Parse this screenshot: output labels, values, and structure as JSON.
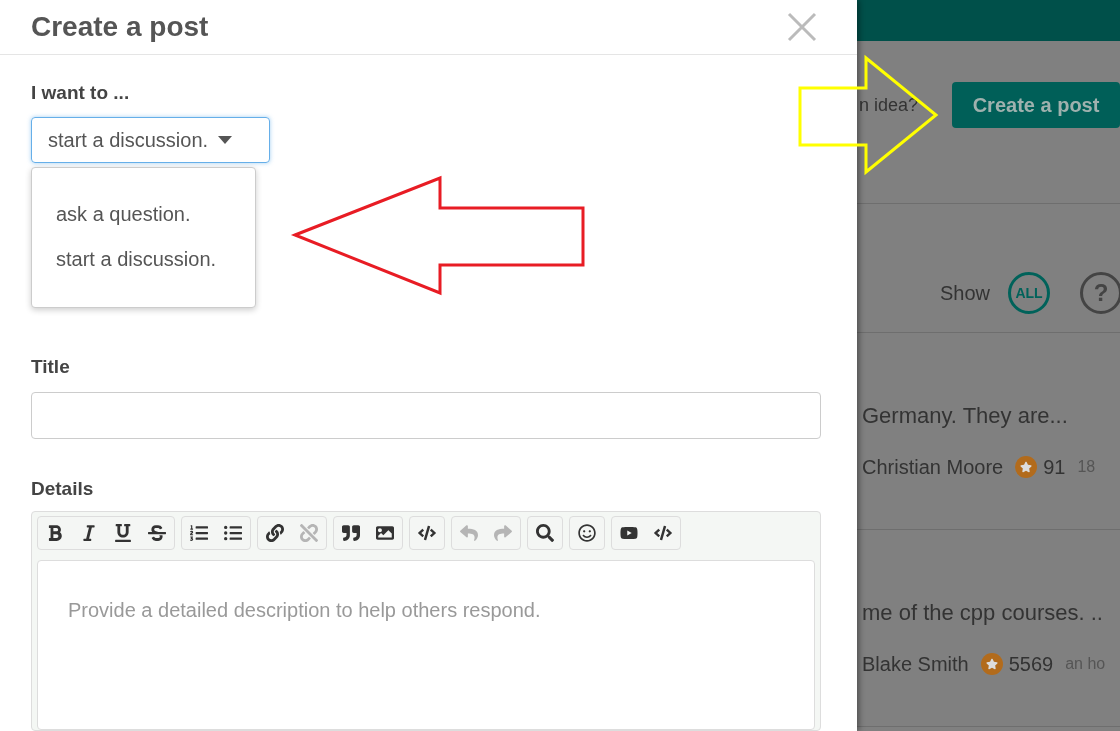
{
  "modal": {
    "title": "Create a post",
    "intent": {
      "label": "I want to ...",
      "value": "start a discussion.",
      "expanded": true,
      "options": [
        {
          "label": "ask a question."
        },
        {
          "label": "start a discussion."
        }
      ]
    },
    "title_field": {
      "label": "Title"
    },
    "details": {
      "label": "Details",
      "placeholder": "Provide a detailed description to help others respond.",
      "toolbar": [
        [
          {
            "kind": "bold",
            "disabled": false
          },
          {
            "kind": "italic",
            "disabled": false
          },
          {
            "kind": "underline",
            "disabled": false
          },
          {
            "kind": "strike",
            "disabled": false
          }
        ],
        [
          {
            "kind": "ordered-list",
            "disabled": false
          },
          {
            "kind": "bullet-list",
            "disabled": false
          }
        ],
        [
          {
            "kind": "link",
            "disabled": false
          },
          {
            "kind": "unlink",
            "disabled": true
          }
        ],
        [
          {
            "kind": "quote",
            "disabled": false
          },
          {
            "kind": "image",
            "disabled": false
          }
        ],
        [
          {
            "kind": "code",
            "disabled": false
          }
        ],
        [
          {
            "kind": "undo",
            "disabled": true
          },
          {
            "kind": "redo",
            "disabled": true
          }
        ],
        [
          {
            "kind": "preview",
            "disabled": false
          }
        ],
        [
          {
            "kind": "emoji",
            "disabled": false
          }
        ],
        [
          {
            "kind": "video",
            "disabled": false
          },
          {
            "kind": "html",
            "disabled": false
          }
        ]
      ]
    }
  },
  "background": {
    "prompt": "n idea?",
    "create_button": "Create a post",
    "show_label": "Show",
    "filters": [
      {
        "label": "ALL",
        "selected": true
      },
      {
        "label": "?",
        "selected": false
      }
    ],
    "posts": [
      {
        "title": "Germany. They are...",
        "author": "Christian Moore",
        "score": "91",
        "time": "18"
      },
      {
        "title": "me of the cpp courses. ..",
        "author": "Blake Smith",
        "score": "5569",
        "time": "an ho"
      }
    ]
  }
}
